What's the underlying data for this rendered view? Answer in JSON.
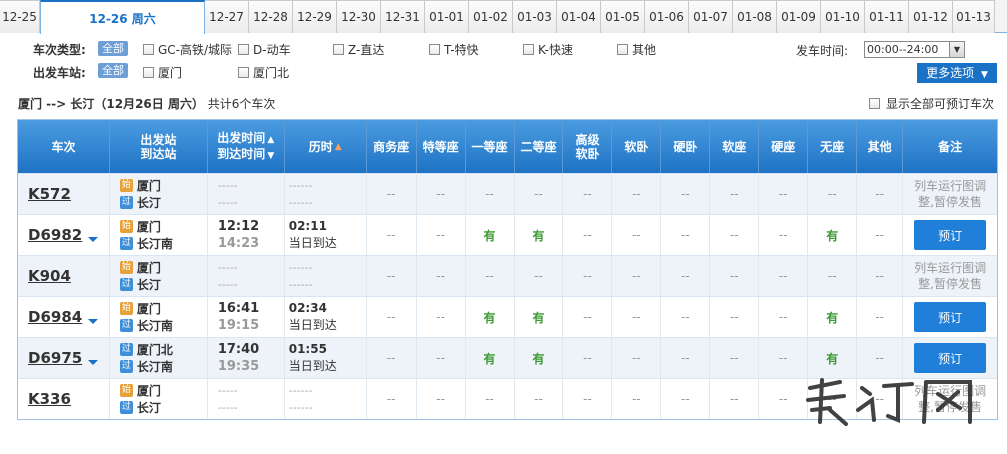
{
  "dates": [
    {
      "label": "12-25",
      "w": 40
    },
    {
      "label": "12-26 周六",
      "w": 165,
      "active": true
    },
    {
      "label": "12-27",
      "w": 44
    },
    {
      "label": "12-28",
      "w": 44
    },
    {
      "label": "12-29",
      "w": 44
    },
    {
      "label": "12-30",
      "w": 44
    },
    {
      "label": "12-31",
      "w": 44
    },
    {
      "label": "01-01",
      "w": 44
    },
    {
      "label": "01-02",
      "w": 44
    },
    {
      "label": "01-03",
      "w": 44
    },
    {
      "label": "01-04",
      "w": 44
    },
    {
      "label": "01-05",
      "w": 44
    },
    {
      "label": "01-06",
      "w": 44
    },
    {
      "label": "01-07",
      "w": 44
    },
    {
      "label": "01-08",
      "w": 44
    },
    {
      "label": "01-09",
      "w": 44
    },
    {
      "label": "01-10",
      "w": 44
    },
    {
      "label": "01-11",
      "w": 44
    },
    {
      "label": "01-12",
      "w": 44
    },
    {
      "label": "01-13",
      "w": 42
    }
  ],
  "filters": {
    "type_label": "车次类型:",
    "station_label": "出发车站:",
    "all": "全部",
    "types": [
      "GC-高铁/城际",
      "D-动车",
      "Z-直达",
      "T-特快",
      "K-快速",
      "其他"
    ],
    "stations": [
      "厦门",
      "厦门北"
    ],
    "time_label": "发车时间:",
    "time_value": "00:00--24:00",
    "more": "更多选项"
  },
  "summary": {
    "route": "厦门 --> 长汀（12月26日  周六）",
    "count": "共计6个车次",
    "show_all": "显示全部可预订车次"
  },
  "headers": {
    "train": "车次",
    "station1": "出发站",
    "station2": "到达站",
    "time1": "出发时间",
    "time2": "到达时间",
    "duration": "历时",
    "swz": "商务座",
    "tdz": "特等座",
    "ydz": "一等座",
    "edz": "二等座",
    "gjrw1": "高级",
    "gjrw2": "软卧",
    "rw": "软卧",
    "yw": "硬卧",
    "rz": "软座",
    "yz": "硬座",
    "wz": "无座",
    "qt": "其他",
    "remark": "备注"
  },
  "badges": {
    "start": "始",
    "pass": "过"
  },
  "rows": [
    {
      "no": "K572",
      "arrow": false,
      "from_badge": "始",
      "from": "厦门",
      "to": "长汀",
      "dep": "-----",
      "arr": "-----",
      "dur": "------",
      "dur_sub": "------",
      "seats": [
        "--",
        "--",
        "--",
        "--",
        "--",
        "--",
        "--",
        "--",
        "--",
        "--",
        "--"
      ],
      "remark": "列车运行图调整,暂停发售",
      "book": ""
    },
    {
      "no": "D6982",
      "arrow": true,
      "from_badge": "始",
      "from": "厦门",
      "to": "长汀南",
      "dep": "12:12",
      "arr": "14:23",
      "dur": "02:11",
      "dur_sub": "当日到达",
      "seats": [
        "--",
        "--",
        "有",
        "有",
        "--",
        "--",
        "--",
        "--",
        "--",
        "有",
        "--"
      ],
      "remark": "",
      "book": "预订"
    },
    {
      "no": "K904",
      "arrow": false,
      "from_badge": "始",
      "from": "厦门",
      "to": "长汀",
      "dep": "-----",
      "arr": "-----",
      "dur": "------",
      "dur_sub": "------",
      "seats": [
        "--",
        "--",
        "--",
        "--",
        "--",
        "--",
        "--",
        "--",
        "--",
        "--",
        "--"
      ],
      "remark": "列车运行图调整,暂停发售",
      "book": ""
    },
    {
      "no": "D6984",
      "arrow": true,
      "from_badge": "始",
      "from": "厦门",
      "to": "长汀南",
      "dep": "16:41",
      "arr": "19:15",
      "dur": "02:34",
      "dur_sub": "当日到达",
      "seats": [
        "--",
        "--",
        "有",
        "有",
        "--",
        "--",
        "--",
        "--",
        "--",
        "有",
        "--"
      ],
      "remark": "",
      "book": "预订"
    },
    {
      "no": "D6975",
      "arrow": true,
      "from_badge": "过",
      "from": "厦门北",
      "to": "长汀南",
      "dep": "17:40",
      "arr": "19:35",
      "dur": "01:55",
      "dur_sub": "当日到达",
      "seats": [
        "--",
        "--",
        "有",
        "有",
        "--",
        "--",
        "--",
        "--",
        "--",
        "有",
        "--"
      ],
      "remark": "",
      "book": "预订"
    },
    {
      "no": "K336",
      "arrow": false,
      "from_badge": "始",
      "from": "厦门",
      "to": "长汀",
      "dep": "-----",
      "arr": "-----",
      "dur": "------",
      "dur_sub": "------",
      "seats": [
        "--",
        "--",
        "--",
        "--",
        "--",
        "--",
        "--",
        "--",
        "--",
        "--",
        "--"
      ],
      "remark": "列车运行图调整,暂停发售",
      "book": ""
    }
  ],
  "watermark": "長汀网",
  "colors": {
    "accent": "#1a72c7",
    "available": "#3d9a34"
  }
}
